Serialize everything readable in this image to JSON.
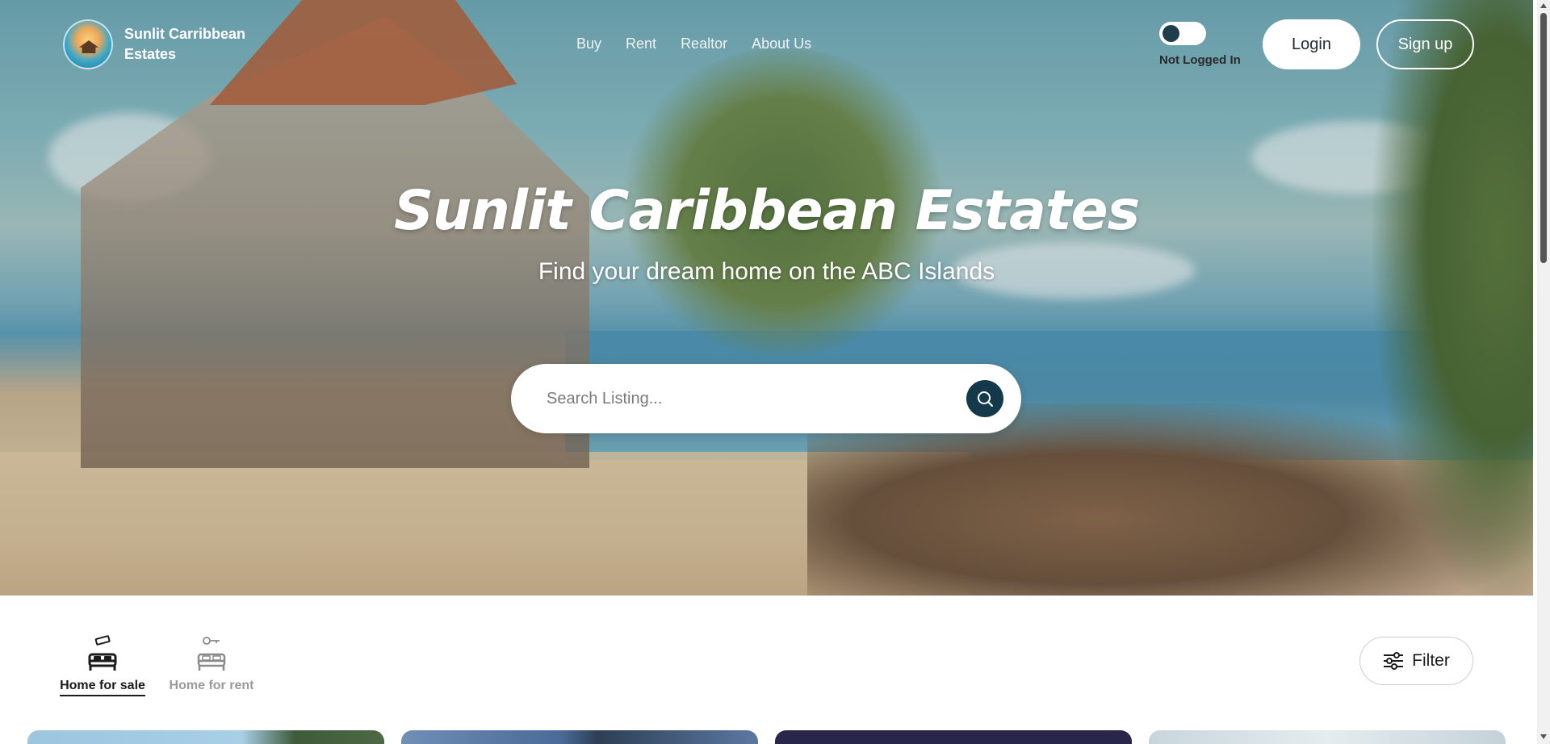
{
  "brand": {
    "name": "Sunlit Carribbean Estates"
  },
  "nav": {
    "items": [
      {
        "label": "Buy"
      },
      {
        "label": "Rent"
      },
      {
        "label": "Realtor"
      },
      {
        "label": "About Us"
      }
    ]
  },
  "auth": {
    "status_label": "Not Logged In",
    "login_label": "Login",
    "signup_label": "Sign up"
  },
  "hero": {
    "title": "Sunlit Caribbean Estates",
    "subtitle": "Find your dream home on the ABC Islands"
  },
  "search": {
    "placeholder": "Search Listing...",
    "icon": "search-icon"
  },
  "tabs": [
    {
      "label": "Home for sale",
      "icon": "bed-money-icon",
      "active": true
    },
    {
      "label": "Home for rent",
      "icon": "bed-key-icon",
      "active": false
    }
  ],
  "filter": {
    "label": "Filter",
    "icon": "sliders-icon"
  },
  "colors": {
    "accent_dark": "#14394a",
    "toggle_knob": "#1f3d4d",
    "inactive_tab": "#9a9a9a"
  }
}
